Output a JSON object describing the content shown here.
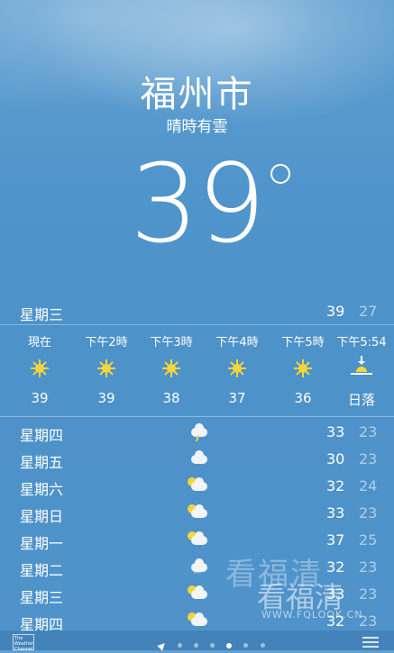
{
  "header": {
    "city": "福州市",
    "condition": "晴時有雲",
    "temperature": "39"
  },
  "today": {
    "day": "星期三",
    "high": "39",
    "low": "27"
  },
  "hourly": [
    {
      "time": "現在",
      "icon": "sun-icon",
      "value": "39"
    },
    {
      "time": "下午2時",
      "icon": "sun-icon",
      "value": "39"
    },
    {
      "time": "下午3時",
      "icon": "sun-icon",
      "value": "38"
    },
    {
      "time": "下午4時",
      "icon": "sun-icon",
      "value": "37"
    },
    {
      "time": "下午5時",
      "icon": "sun-icon",
      "value": "36"
    },
    {
      "time": "下午5:54",
      "icon": "sunset-icon",
      "value": "日落"
    }
  ],
  "daily": [
    {
      "day": "星期四",
      "icon": "thunderstorm-icon",
      "high": "33",
      "low": "23"
    },
    {
      "day": "星期五",
      "icon": "cloud-icon",
      "high": "30",
      "low": "23"
    },
    {
      "day": "星期六",
      "icon": "partly-cloudy-icon",
      "high": "32",
      "low": "24"
    },
    {
      "day": "星期日",
      "icon": "partly-cloudy-icon",
      "high": "33",
      "low": "23"
    },
    {
      "day": "星期一",
      "icon": "partly-cloudy-icon",
      "high": "37",
      "low": "25"
    },
    {
      "day": "星期二",
      "icon": "rain-icon",
      "high": "32",
      "low": "23"
    },
    {
      "day": "星期三",
      "icon": "partly-cloudy-icon",
      "high": "33",
      "low": "23"
    },
    {
      "day": "星期四",
      "icon": "partly-cloudy-icon",
      "high": "32",
      "low": "23"
    }
  ],
  "watermark": {
    "text1": "看福清",
    "text2": "看福清",
    "url": "WWW.FQLOOK.CN"
  },
  "footer": {
    "logo_text": "The Weather Channel"
  },
  "colors": {
    "sun": "#f6d43b",
    "background": "#4d92c9"
  }
}
